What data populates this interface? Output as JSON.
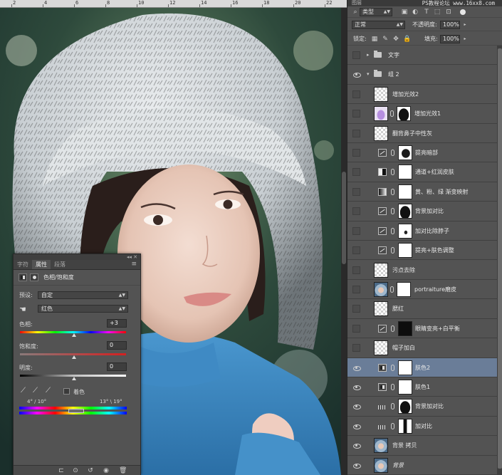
{
  "canvas": {
    "ruler_labels": [
      "2",
      "4",
      "6",
      "8",
      "10",
      "12",
      "14",
      "16",
      "18",
      "20",
      "22"
    ]
  },
  "properties_panel": {
    "tabs": [
      "字符",
      "属性",
      "段落"
    ],
    "active_tab": "属性",
    "title": "色相/饱和度",
    "preset_label": "预设:",
    "preset_value": "自定",
    "channel_value": "红色",
    "hue_label": "色相:",
    "hue_value": "+3",
    "saturation_label": "饱和度:",
    "saturation_value": "0",
    "lightness_label": "明度:",
    "lightness_value": "0",
    "colorize_label": "着色",
    "range_left": "4° / 10°",
    "range_right": "13° \\ 19°"
  },
  "layers_panel": {
    "tab_label": "图层",
    "watermark": "PS教程论坛  www.16xx8.com",
    "filter_label": "类型",
    "blend_mode": "正常",
    "opacity_label": "不透明度:",
    "opacity_value": "100%",
    "lock_label": "锁定:",
    "fill_label": "填充:",
    "fill_value": "100%",
    "layers": [
      {
        "name": "文字",
        "visible": false,
        "kind": "group-collapsed"
      },
      {
        "name": "组 2",
        "visible": true,
        "kind": "group-open"
      },
      {
        "name": "增加光效2",
        "visible": false,
        "kind": "pixel",
        "thumb": "trans"
      },
      {
        "name": "增加光效1",
        "visible": false,
        "kind": "pixel-mask",
        "thumb": "violet",
        "mask": "mask-dark"
      },
      {
        "name": "翻背鼻子中性灰",
        "visible": false,
        "kind": "pixel",
        "thumb": "trans"
      },
      {
        "name": "提亮暗部",
        "visible": false,
        "kind": "adjust",
        "icon": "curves",
        "mask": "mask-fig"
      },
      {
        "name": "通道+红润皮肤",
        "visible": false,
        "kind": "adjust",
        "icon": "channel",
        "mask": "white"
      },
      {
        "name": "黄、粉、绿 渐变映射",
        "visible": false,
        "kind": "adjust",
        "icon": "grad",
        "mask": "white"
      },
      {
        "name": "背景加对比",
        "visible": false,
        "kind": "adjust",
        "icon": "curves",
        "mask": "mask-dark"
      },
      {
        "name": "加对比除脖子",
        "visible": false,
        "kind": "adjust",
        "icon": "curves",
        "mask": "mask-light"
      },
      {
        "name": "提亮+肤色调整",
        "visible": false,
        "kind": "adjust",
        "icon": "curves",
        "mask": "white"
      },
      {
        "name": "污点去除",
        "visible": false,
        "kind": "pixel",
        "thumb": "trans"
      },
      {
        "name": "portraiture磨皮",
        "visible": false,
        "kind": "pixel-mask",
        "thumb": "photo",
        "mask": "white"
      },
      {
        "name": "腮红",
        "visible": false,
        "kind": "pixel",
        "thumb": "trans"
      },
      {
        "name": "眼睛变亮+白平衡",
        "visible": false,
        "kind": "adjust",
        "icon": "curves",
        "mask": "mask-blk"
      },
      {
        "name": "帽子加白",
        "visible": false,
        "kind": "pixel",
        "thumb": "trans"
      },
      {
        "name": "肤色2",
        "visible": true,
        "kind": "adjust",
        "icon": "hs",
        "mask": "white",
        "selected": true
      },
      {
        "name": "肤色1",
        "visible": true,
        "kind": "adjust",
        "icon": "hs",
        "mask": "white"
      },
      {
        "name": "背景加对比",
        "visible": true,
        "kind": "adjust",
        "icon": "levels",
        "mask": "mask-dark"
      },
      {
        "name": "加对比",
        "visible": true,
        "kind": "adjust",
        "icon": "levels",
        "mask": "mask-half"
      },
      {
        "name": "背景 拷贝",
        "visible": true,
        "kind": "pixel",
        "thumb": "photo"
      },
      {
        "name": "背景",
        "visible": true,
        "kind": "pixel",
        "thumb": "photo",
        "italic": true
      }
    ]
  }
}
